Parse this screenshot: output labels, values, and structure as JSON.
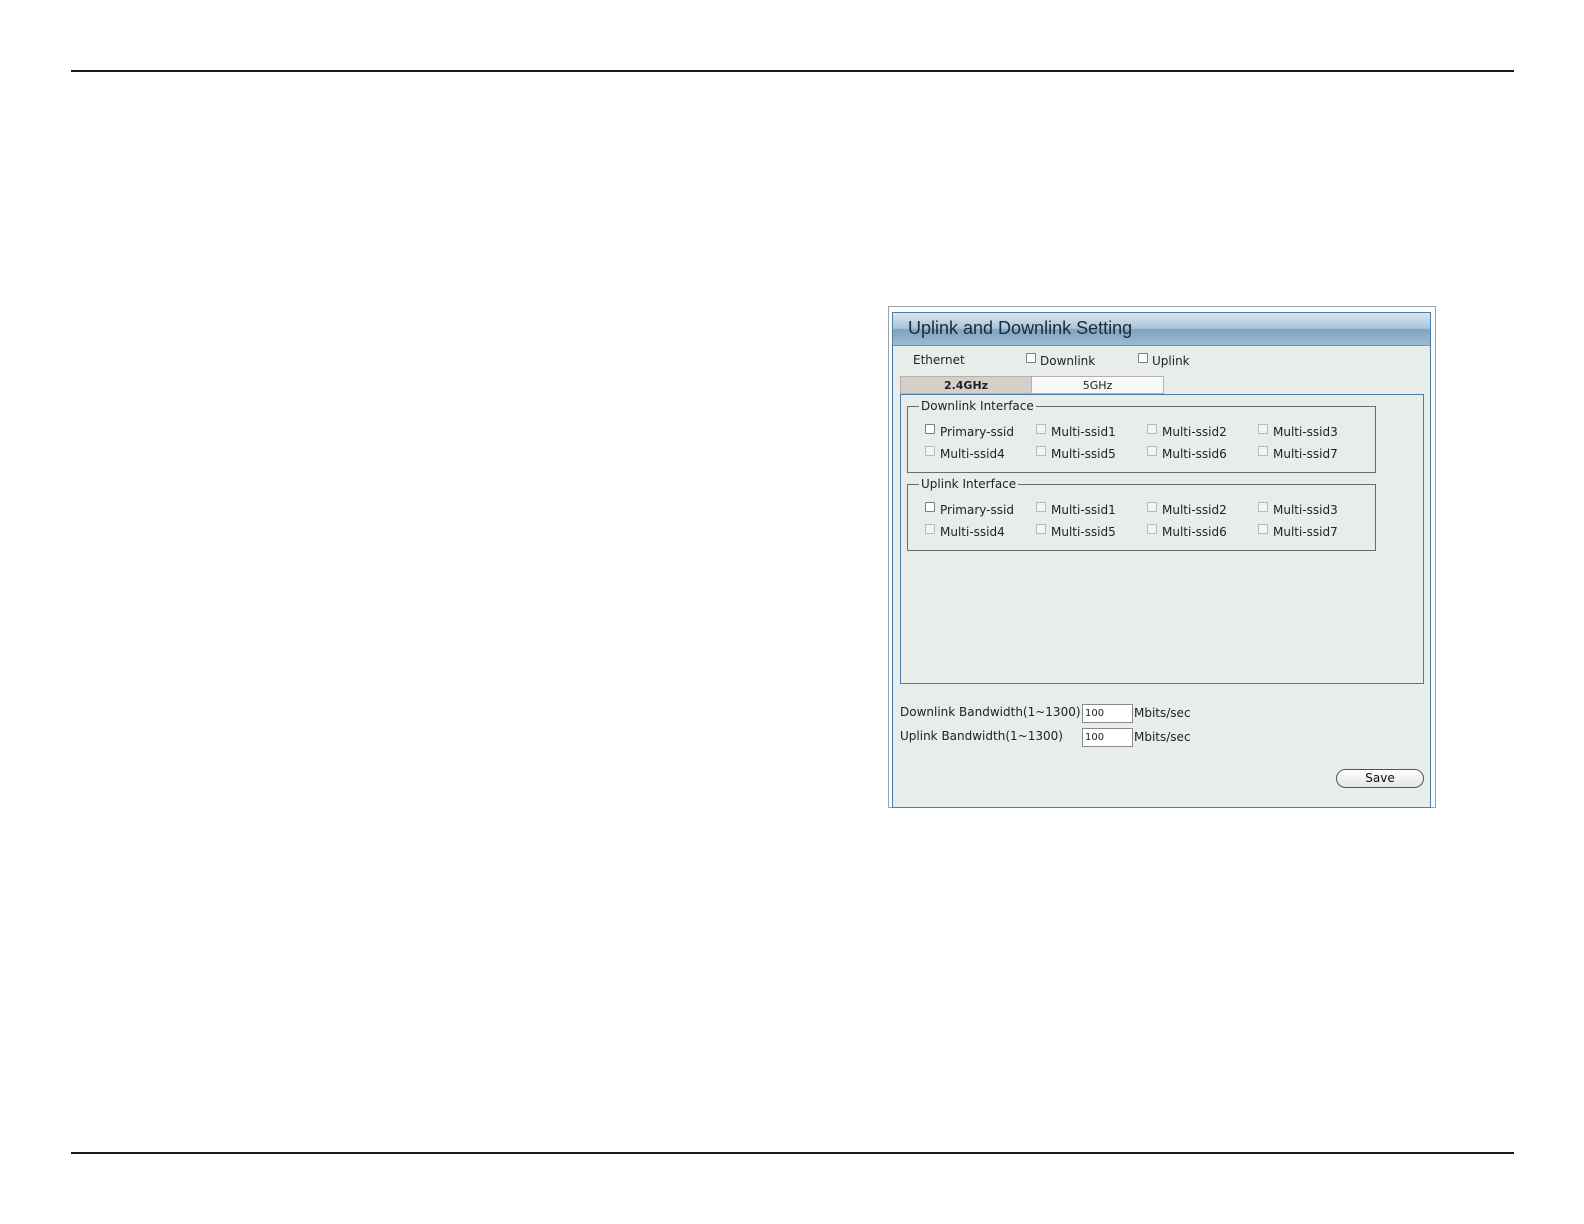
{
  "panel": {
    "title": "Uplink and Downlink Setting"
  },
  "ethernet": {
    "label": "Ethernet",
    "downlink_label": "Downlink",
    "uplink_label": "Uplink"
  },
  "tabs": [
    {
      "label": "2.4GHz",
      "active": true
    },
    {
      "label": "5GHz",
      "active": false
    }
  ],
  "downlink_interface": {
    "legend": "Downlink Interface",
    "items": [
      "Primary-ssid",
      "Multi-ssid1",
      "Multi-ssid2",
      "Multi-ssid3",
      "Multi-ssid4",
      "Multi-ssid5",
      "Multi-ssid6",
      "Multi-ssid7"
    ]
  },
  "uplink_interface": {
    "legend": "Uplink Interface",
    "items": [
      "Primary-ssid",
      "Multi-ssid1",
      "Multi-ssid2",
      "Multi-ssid3",
      "Multi-ssid4",
      "Multi-ssid5",
      "Multi-ssid6",
      "Multi-ssid7"
    ]
  },
  "bandwidth": {
    "downlink_label": "Downlink Bandwidth(1~1300)",
    "downlink_value": "100",
    "uplink_label": "Uplink Bandwidth(1~1300)",
    "uplink_value": "100",
    "unit": "Mbits/sec"
  },
  "save_label": "Save"
}
